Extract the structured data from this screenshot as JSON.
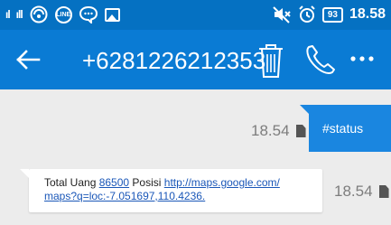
{
  "status_bar": {
    "signal_1": "ıl",
    "signal_2": "ıll",
    "line_icon_text": "LINE",
    "battery": "93",
    "time": "18.58",
    "icons": [
      "signal-bars-icon",
      "wifi-icon",
      "line-app-icon",
      "chat-bubble-icon",
      "image-icon",
      "mute-icon",
      "alarm-icon",
      "battery-icon"
    ]
  },
  "app_bar": {
    "title": "+6281226212353",
    "icons": [
      "back-arrow-icon",
      "trash-icon",
      "phone-icon",
      "more-vert-icon"
    ]
  },
  "messages": {
    "outgoing": {
      "text": "#status",
      "time": "18.54"
    },
    "incoming": {
      "part1": "Total Uang ",
      "amount": "86500",
      "part2": " Posisi ",
      "link_line1": "http://maps.google.com/",
      "link_line2": "maps?q=loc:-7.051697,110.4236.",
      "time": "18.54"
    }
  },
  "colors": {
    "status_bar": "#0571c2",
    "app_bar": "#0a7bd4",
    "outgoing_bubble": "#1a86e0",
    "background": "#ececec",
    "link": "#1a57b8"
  }
}
